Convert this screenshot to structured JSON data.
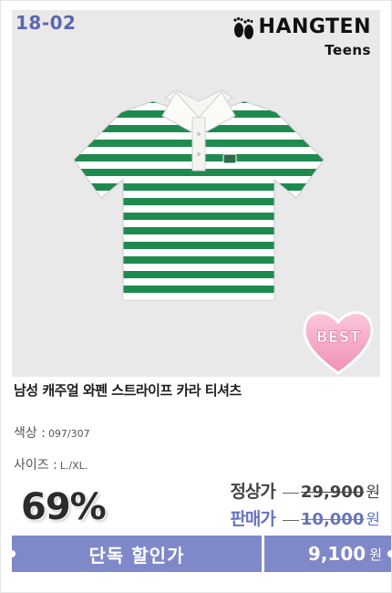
{
  "product": {
    "code": "18-02",
    "brand_name": "HANGTEN",
    "brand_sub": "Teens",
    "badge": "BEST",
    "title": "남성 캐주얼 와펜 스트라이프 카라 티셔츠"
  },
  "options": {
    "color_label": "색상 :",
    "color_value": "097/307",
    "size_label": "사이즈 :",
    "size_value": "L./XL."
  },
  "pricing": {
    "discount": "69%",
    "regular_label": "정상가",
    "regular_price": "29,900",
    "sale_label": "판매가",
    "sale_price": "10,000",
    "currency": "원",
    "exclusive_label": "단독 할인가",
    "exclusive_price": "9,100"
  },
  "colors": {
    "accent": "#7f88c8",
    "code_text": "#5b67b2",
    "stripe_green": "#1f8a4f",
    "badge_pink": "#f7a9c6"
  },
  "icons": [
    "footprints-icon",
    "heart-badge-icon"
  ]
}
